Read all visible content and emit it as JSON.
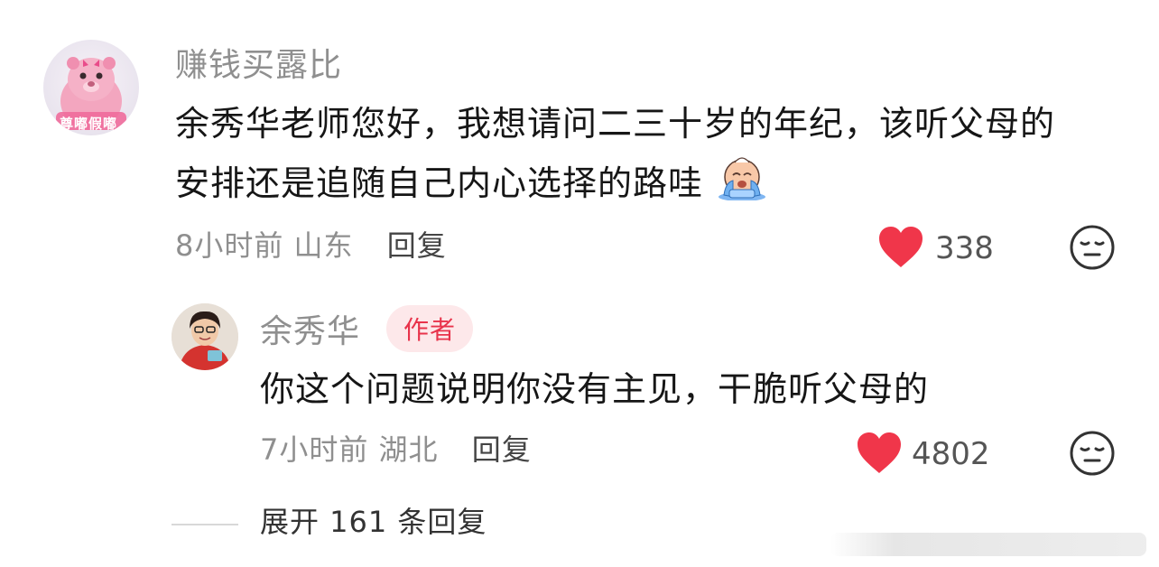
{
  "comment": {
    "username": "赚钱买露比",
    "avatar_text": "尊嘟假嘟",
    "text_line1": "余秀华老师您好，我想请问二三十岁的年纪，该听父母的",
    "text_line2": "安排还是追随自己内心选择的路哇",
    "emoji": "crying-emoji",
    "time_location": "8小时前 山东",
    "reply_label": "回复",
    "likes": "338",
    "like_icon": "heart-icon",
    "dislike_icon": "meh-face-icon",
    "like_color": "#f0364a"
  },
  "reply": {
    "username": "余秀华",
    "author_badge": "作者",
    "text": "你这个问题说明你没有主见，干脆听父母的",
    "time_location": "7小时前 湖北",
    "reply_label": "回复",
    "likes": "4802"
  },
  "expand_label": "展开 161 条回复"
}
